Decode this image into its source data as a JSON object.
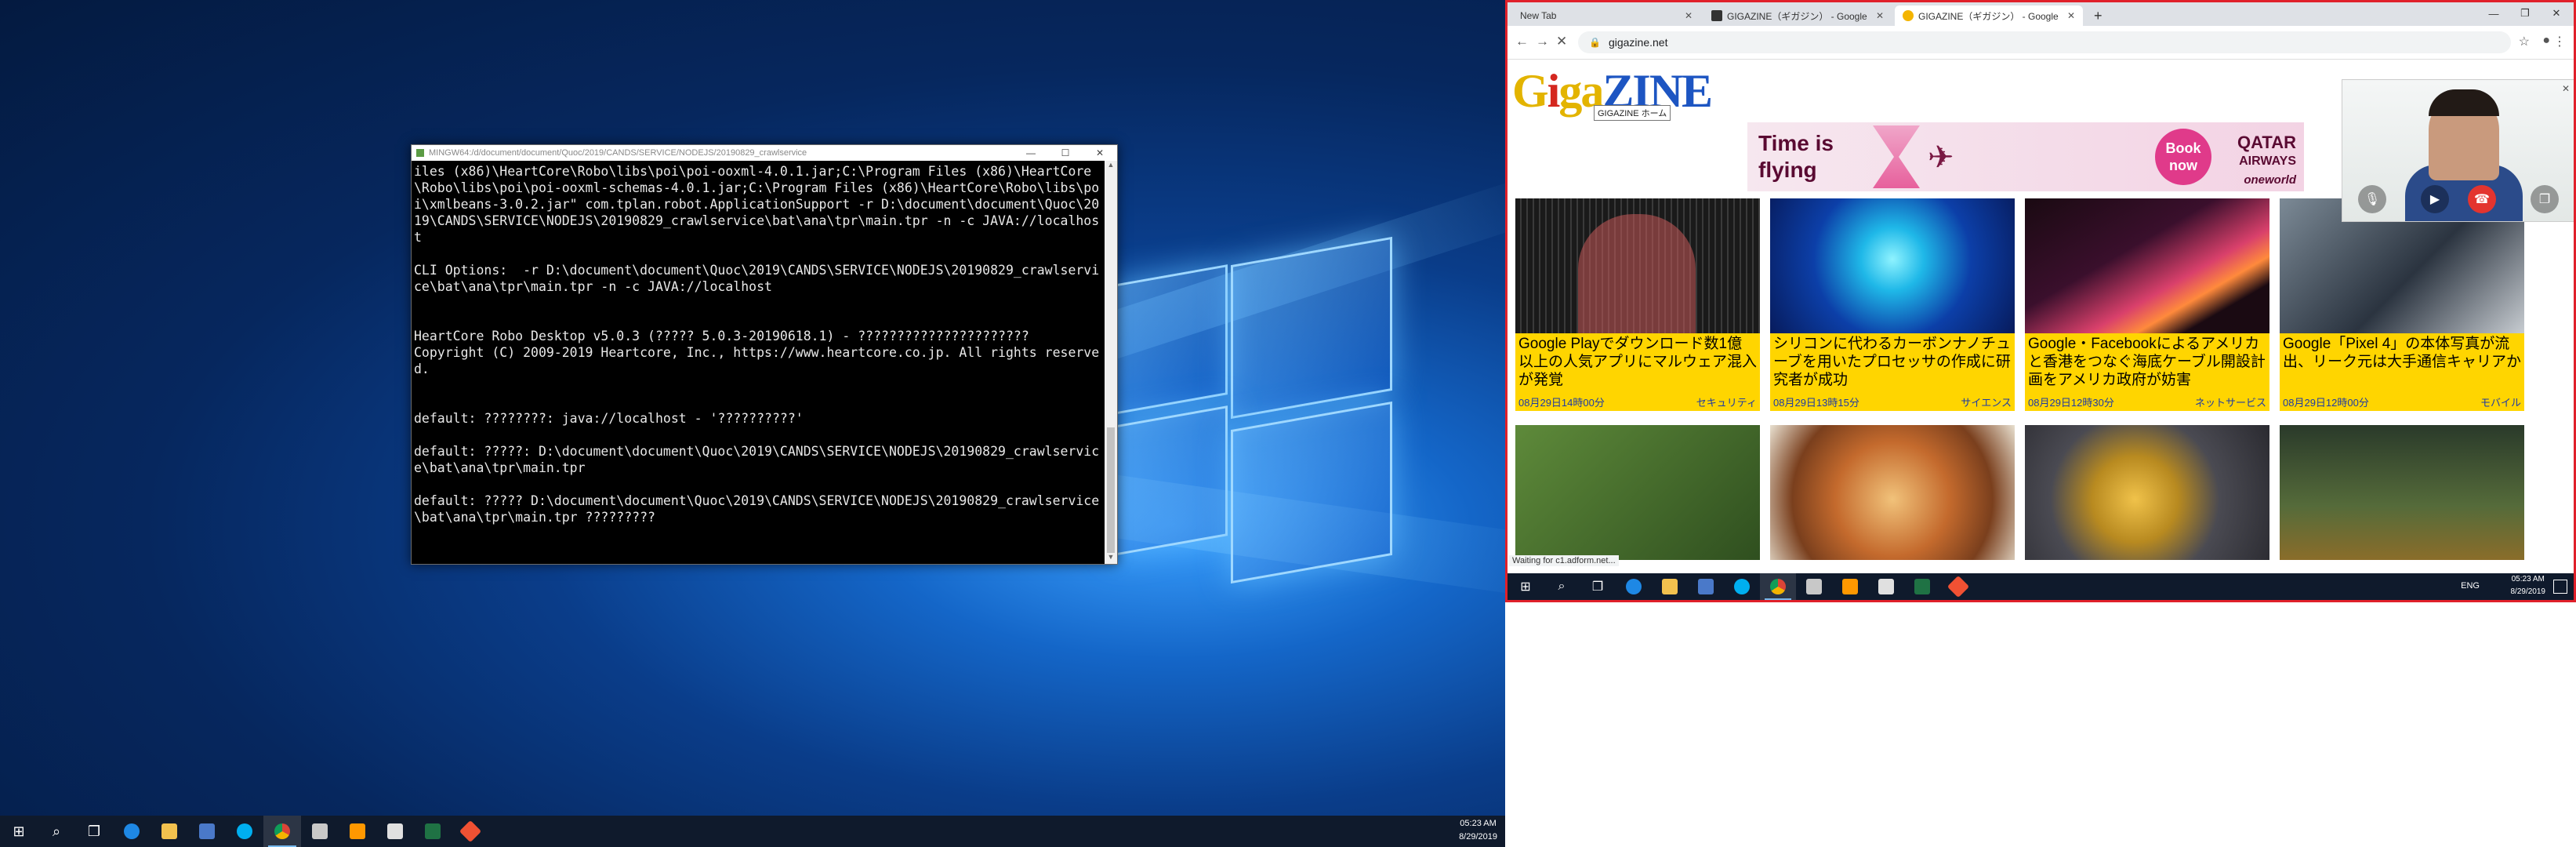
{
  "terminal": {
    "title": "MINGW64:/d/document/document/Quoc/2019/CANDS/SERVICE/NODEJS/20190829_crawlservice",
    "lines": "iles (x86)\\HeartCore\\Robo\\libs\\poi\\poi-ooxml-4.0.1.jar;C:\\Program Files (x86)\\HeartCore\\Robo\\libs\\poi\\poi-ooxml-schemas-4.0.1.jar;C:\\Program Files (x86)\\HeartCore\\Robo\\libs\\poi\\xmlbeans-3.0.2.jar\" com.tplan.robot.ApplicationSupport -r D:\\document\\document\\Quoc\\2019\\CANDS\\SERVICE\\NODEJS\\20190829_crawlservice\\bat\\ana\\tpr\\main.tpr -n -c JAVA://localhost\n\nCLI Options:  -r D:\\document\\document\\Quoc\\2019\\CANDS\\SERVICE\\NODEJS\\20190829_crawlservice\\bat\\ana\\tpr\\main.tpr -n -c JAVA://localhost\n\n\nHeartCore Robo Desktop v5.0.3 (????? 5.0.3-20190618.1) - ??????????????????????\nCopyright (C) 2009-2019 Heartcore, Inc., https://www.heartcore.co.jp. All rights reserved.\n\n\ndefault: ????????: java://localhost - '??????????'\n\ndefault: ?????: D:\\document\\document\\Quoc\\2019\\CANDS\\SERVICE\\NODEJS\\20190829_crawlservice\\bat\\ana\\tpr\\main.tpr\n\ndefault: ????? D:\\document\\document\\Quoc\\2019\\CANDS\\SERVICE\\NODEJS\\20190829_crawlservice\\bat\\ana\\tpr\\main.tpr ?????????"
  },
  "taskbar_left": {
    "time": "05:23 AM",
    "date": "8/29/2019"
  },
  "browser": {
    "tabs": [
      {
        "label": "New Tab"
      },
      {
        "label": "GIGAZINE（ギガジン） - Google"
      },
      {
        "label": "GIGAZINE（ギガジン） - Google"
      }
    ],
    "url": "gigazine.net",
    "status": "Waiting for c1.adform.net...",
    "logo_tooltip": "GIGAZINE ホーム",
    "ad": {
      "headline_1": "Time is",
      "headline_2": "flying",
      "cta_1": "Book",
      "cta_2": "now",
      "brand_1": "QATAR",
      "brand_2": "AIRWAYS",
      "brand_3": "oneworld"
    },
    "articles": [
      {
        "title": "Google Playでダウンロード数1億以上の人気アプリにマルウェア混入が発覚",
        "time": "08月29日14時00分",
        "category": "セキュリティ"
      },
      {
        "title": "シリコンに代わるカーボンナノチューブを用いたプロセッサの作成に研究者が成功",
        "time": "08月29日13時15分",
        "category": "サイエンス"
      },
      {
        "title": "Google・Facebookによるアメリカと香港をつなぐ海底ケーブル開設計画をアメリカ政府が妨害",
        "time": "08月29日12時30分",
        "category": "ネットサービス"
      },
      {
        "title": "Google「Pixel 4」の本体写真が流出、リーク元は大手通信キャリアか",
        "time": "08月29日12時00分",
        "category": "モバイル"
      }
    ]
  },
  "taskbar_right": {
    "lang": "ENG",
    "time": "05:23 AM",
    "date": "8/29/2019"
  }
}
